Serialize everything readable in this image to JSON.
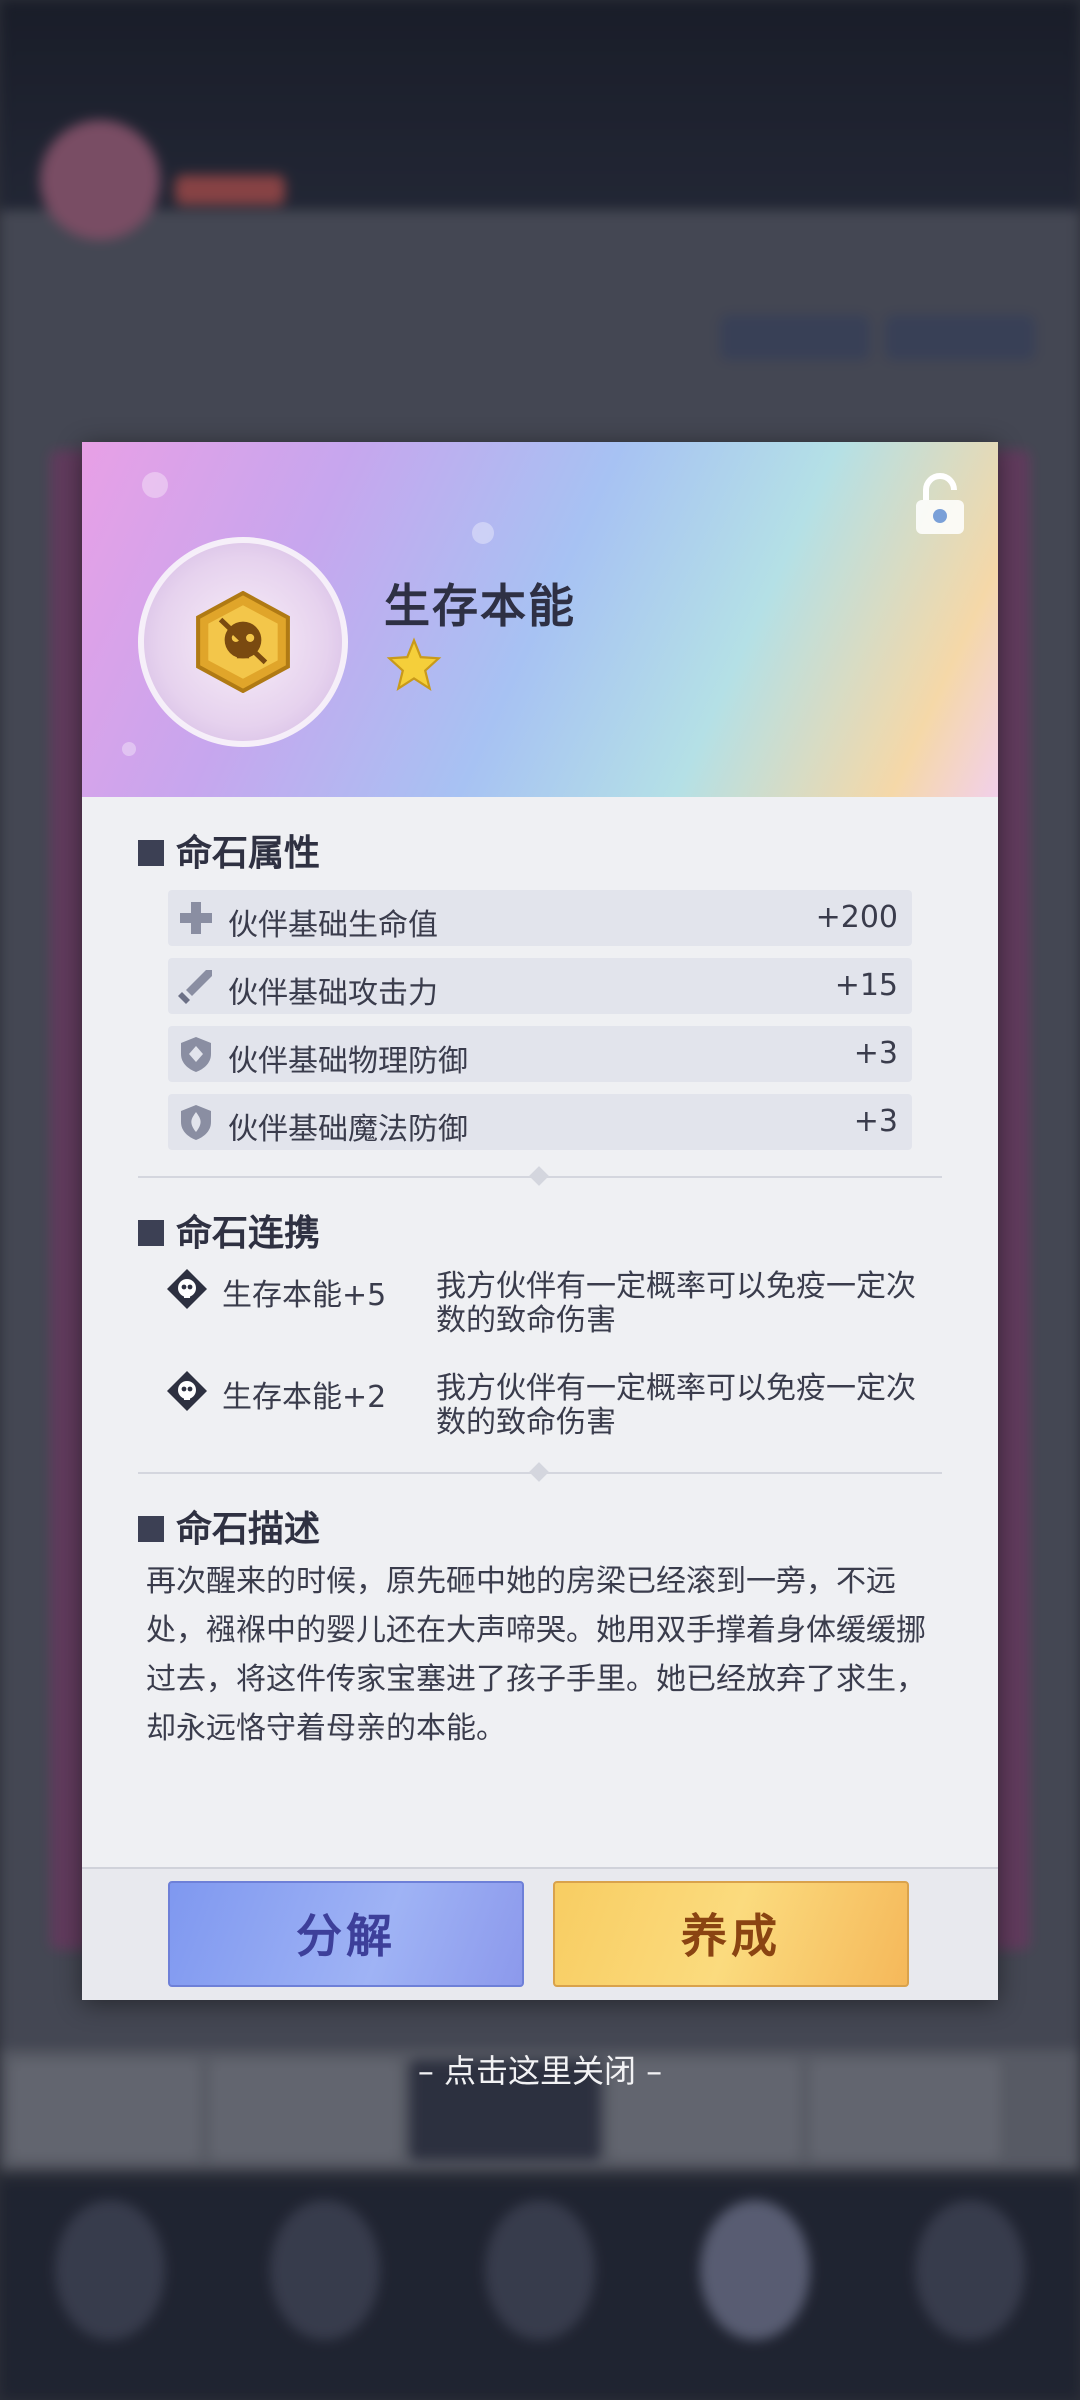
{
  "stone": {
    "name": "生存本能",
    "stars": 1,
    "emblem_icon": "skull-hexagon-icon",
    "lock_icon": "unlock-icon"
  },
  "attributes": {
    "title": "命石属性",
    "items": [
      {
        "icon": "health-cross-icon",
        "name": "伙伴基础生命值",
        "value": "+200"
      },
      {
        "icon": "sword-icon",
        "name": "伙伴基础攻击力",
        "value": "+15"
      },
      {
        "icon": "shield-icon",
        "name": "伙伴基础物理防御",
        "value": "+3"
      },
      {
        "icon": "magic-shield-icon",
        "name": "伙伴基础魔法防御",
        "value": "+3"
      }
    ]
  },
  "links": {
    "title": "命石连携",
    "items": [
      {
        "icon": "skull-diamond-icon",
        "name": "生存本能+5",
        "desc": "我方伙伴有一定概率可以免疫一定次数的致命伤害"
      },
      {
        "icon": "skull-diamond-icon",
        "name": "生存本能+2",
        "desc": "我方伙伴有一定概率可以免疫一定次数的致命伤害"
      }
    ]
  },
  "description": {
    "title": "命石描述",
    "text": "再次醒来的时候，原先砸中她的房梁已经滚到一旁，不远处，襁褓中的婴儿还在大声啼哭。她用双手撑着身体缓缓挪过去，将这件传家宝塞进了孩子手里。她已经放弃了求生，却永远恪守着母亲的本能。"
  },
  "buttons": {
    "disassemble": "分解",
    "develop": "养成"
  },
  "close_hint": "– 点击这里关闭 –",
  "colors": {
    "accent_dark": "#3c4054",
    "disassemble_button": "#8c9ff0",
    "develop_button": "#f8cd62"
  }
}
